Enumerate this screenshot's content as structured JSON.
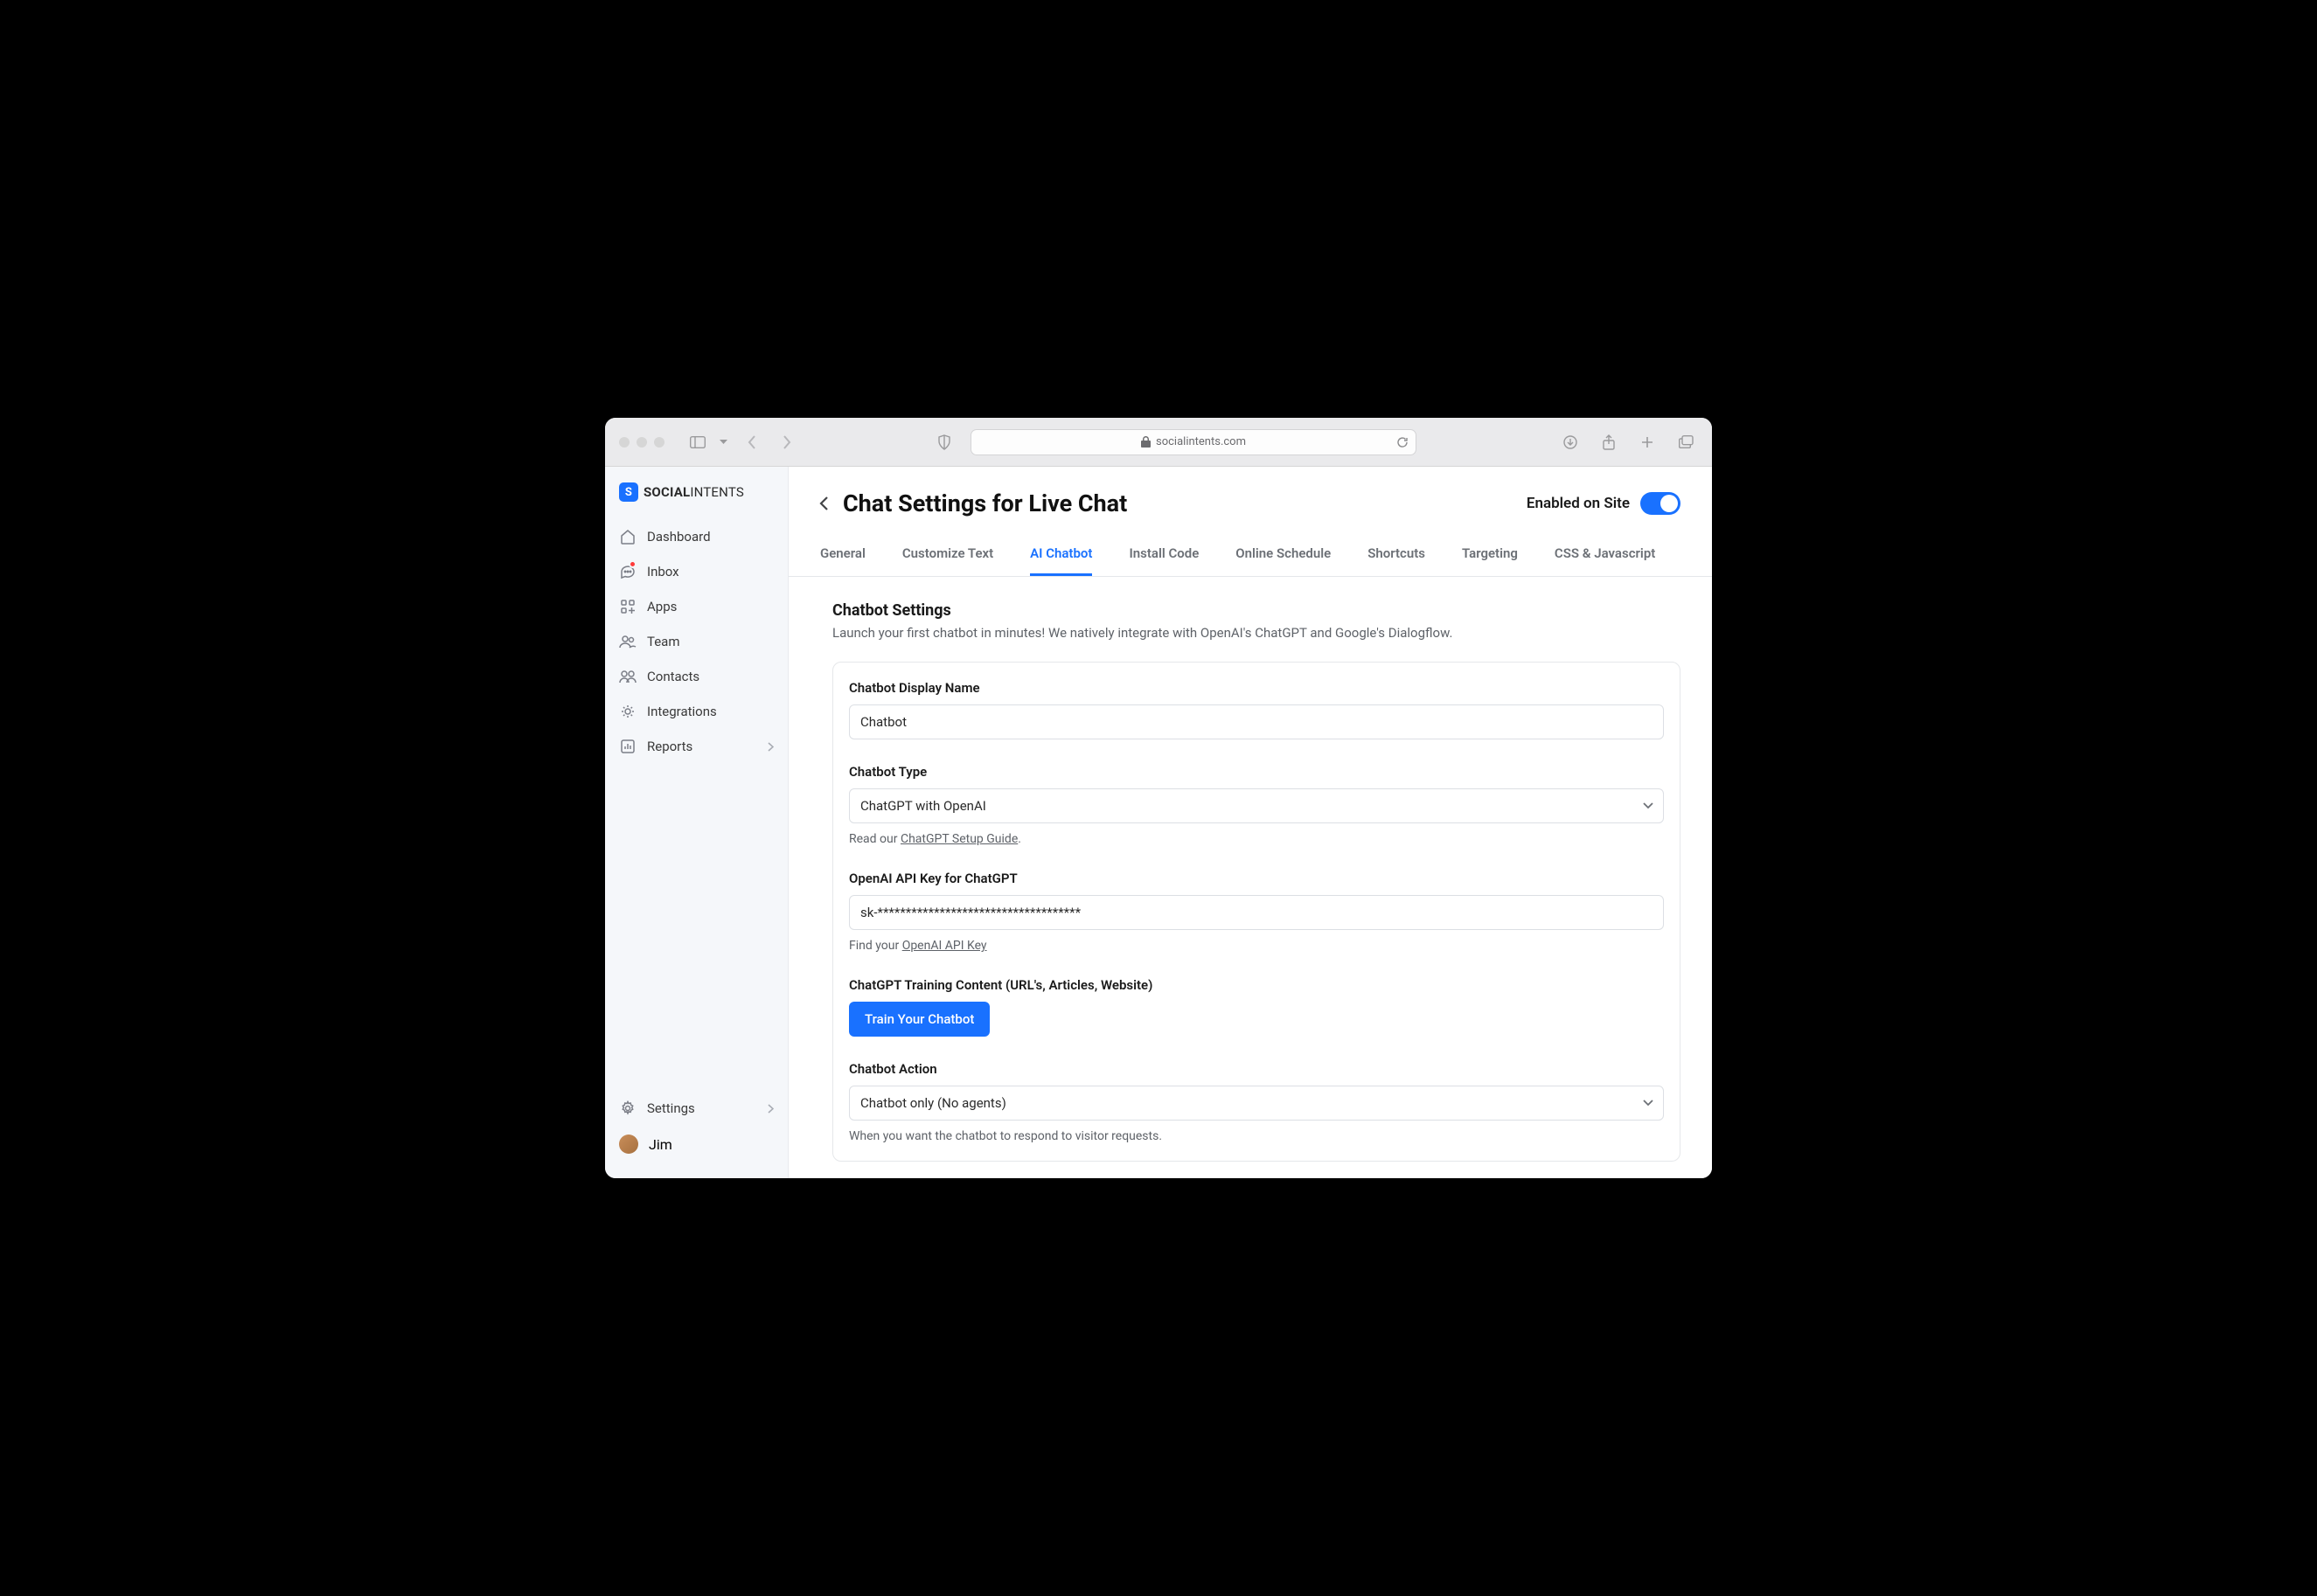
{
  "browser": {
    "url": "socialintents.com"
  },
  "logo": {
    "bold": "SOCIAL",
    "thin": "INTENTS"
  },
  "sidebar": {
    "items": [
      {
        "label": "Dashboard"
      },
      {
        "label": "Inbox"
      },
      {
        "label": "Apps"
      },
      {
        "label": "Team"
      },
      {
        "label": "Contacts"
      },
      {
        "label": "Integrations"
      },
      {
        "label": "Reports"
      }
    ],
    "settings_label": "Settings",
    "user_name": "Jim"
  },
  "header": {
    "title": "Chat Settings for Live Chat",
    "enabled_label": "Enabled on Site"
  },
  "tabs": [
    {
      "label": "General"
    },
    {
      "label": "Customize Text"
    },
    {
      "label": "AI Chatbot"
    },
    {
      "label": "Install Code"
    },
    {
      "label": "Online Schedule"
    },
    {
      "label": "Shortcuts"
    },
    {
      "label": "Targeting"
    },
    {
      "label": "CSS & Javascript"
    }
  ],
  "section": {
    "title": "Chatbot Settings",
    "description": "Launch your first chatbot in minutes! We natively integrate with OpenAI's ChatGPT and Google's Dialogflow."
  },
  "fields": {
    "display_name": {
      "label": "Chatbot Display Name",
      "value": "Chatbot"
    },
    "chatbot_type": {
      "label": "Chatbot Type",
      "value": "ChatGPT with OpenAI",
      "helper_prefix": "Read our ",
      "helper_link": "ChatGPT Setup Guide",
      "helper_suffix": "."
    },
    "api_key": {
      "label": "OpenAI API Key for ChatGPT",
      "value": "sk-************************************",
      "helper_prefix": "Find your ",
      "helper_link": "OpenAI API Key"
    },
    "training": {
      "label": "ChatGPT Training Content (URL's, Articles, Website)",
      "button": "Train Your Chatbot"
    },
    "chatbot_action": {
      "label": "Chatbot Action",
      "value": "Chatbot only (No agents)",
      "helper": "When you want the chatbot to respond to visitor requests."
    }
  }
}
